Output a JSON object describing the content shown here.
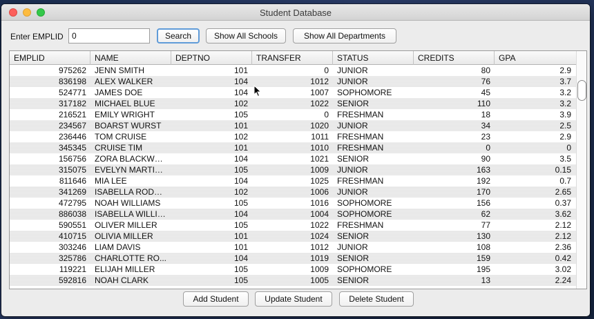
{
  "window": {
    "title": "Student Database"
  },
  "search": {
    "label": "Enter EMPLID",
    "value": "0",
    "search_button": "Search",
    "schools_button": "Show All Schools",
    "departments_button": "Show All Departments"
  },
  "table": {
    "columns": [
      "EMPLID",
      "NAME",
      "DEPTNO",
      "TRANSFER",
      "STATUS",
      "CREDITS",
      "GPA"
    ],
    "rows": [
      [
        "975262",
        "JENN SMITH",
        "101",
        "0",
        "JUNIOR",
        "80",
        "2.9"
      ],
      [
        "836198",
        "ALEX WALKER",
        "104",
        "1012",
        "JUNIOR",
        "76",
        "3.7"
      ],
      [
        "524771",
        "JAMES DOE",
        "104",
        "1007",
        "SOPHOMORE",
        "45",
        "3.2"
      ],
      [
        "317182",
        "MICHAEL BLUE",
        "102",
        "1022",
        "SENIOR",
        "110",
        "3.2"
      ],
      [
        "216521",
        "EMILY WRIGHT",
        "105",
        "0",
        "FRESHMAN",
        "18",
        "3.9"
      ],
      [
        "234567",
        "BOARST WURST",
        "101",
        "1020",
        "JUNIOR",
        "34",
        "2.5"
      ],
      [
        "236446",
        "TOM CRUISE",
        "102",
        "1011",
        "FRESHMAN",
        "23",
        "2.9"
      ],
      [
        "345345",
        "CRUISE TIM",
        "101",
        "1010",
        "FRESHMAN",
        "0",
        "0"
      ],
      [
        "156756",
        "ZORA BLACKWO...",
        "104",
        "1021",
        "SENIOR",
        "90",
        "3.5"
      ],
      [
        "315075",
        "EVELYN MARTIN...",
        "105",
        "1009",
        "JUNIOR",
        "163",
        "0.15"
      ],
      [
        "811646",
        "MIA LEE",
        "104",
        "1025",
        "FRESHMAN",
        "192",
        "0.7"
      ],
      [
        "341269",
        "ISABELLA RODRI...",
        "102",
        "1006",
        "JUNIOR",
        "170",
        "2.65"
      ],
      [
        "472795",
        "NOAH WILLIAMS",
        "105",
        "1016",
        "SOPHOMORE",
        "156",
        "0.37"
      ],
      [
        "886038",
        "ISABELLA WILLIAMS",
        "104",
        "1004",
        "SOPHOMORE",
        "62",
        "3.62"
      ],
      [
        "590551",
        "OLIVER MILLER",
        "105",
        "1022",
        "FRESHMAN",
        "77",
        "2.12"
      ],
      [
        "410715",
        "OLIVIA MILLER",
        "101",
        "1024",
        "SENIOR",
        "130",
        "2.12"
      ],
      [
        "303246",
        "LIAM DAVIS",
        "101",
        "1012",
        "JUNIOR",
        "108",
        "2.36"
      ],
      [
        "325786",
        "CHARLOTTE RO...",
        "104",
        "1019",
        "SENIOR",
        "159",
        "0.42"
      ],
      [
        "119221",
        "ELIJAH MILLER",
        "105",
        "1009",
        "SOPHOMORE",
        "195",
        "3.02"
      ],
      [
        "592816",
        "NOAH CLARK",
        "105",
        "1005",
        "SENIOR",
        "13",
        "2.24"
      ]
    ]
  },
  "actions": {
    "add": "Add Student",
    "update": "Update Student",
    "delete": "Delete Student"
  },
  "colors": {
    "focus_ring": "#5f9bd8",
    "close": "#fc605c",
    "minimize": "#fdbc40",
    "maximize": "#34c84a"
  }
}
